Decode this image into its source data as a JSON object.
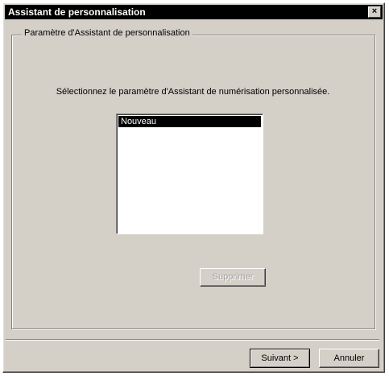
{
  "window": {
    "title": "Assistant de personnalisation",
    "close_glyph": "×"
  },
  "group": {
    "legend": "Paramètre d'Assistant de personnalisation"
  },
  "instruction": "Sélectionnez le paramètre d'Assistant de numérisation personnalisée.",
  "list": {
    "items": [
      {
        "label": "Nouveau",
        "selected": true
      }
    ]
  },
  "buttons": {
    "delete_label": "Supprimer",
    "next_label": "Suivant >",
    "cancel_label": "Annuler"
  },
  "colors": {
    "titlebar": "#000000",
    "face": "#d4d0c8",
    "selection": "#000000"
  }
}
